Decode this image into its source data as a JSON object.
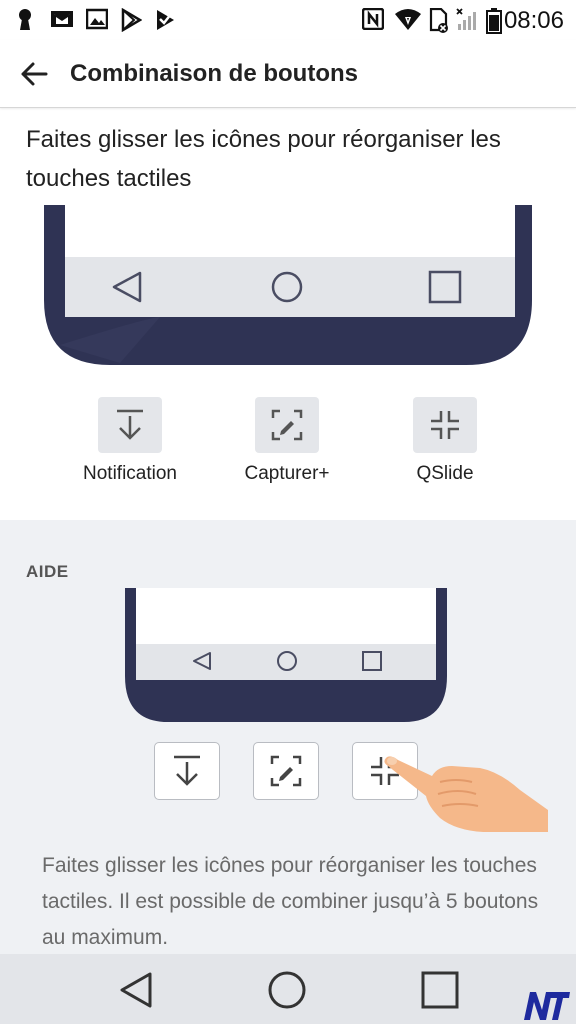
{
  "status_bar": {
    "time": "08:06",
    "left_icons": [
      "keyhole-icon",
      "gmail-icon",
      "gallery-icon",
      "play-store-icon",
      "play-check-icon"
    ],
    "right_icons": [
      "nfc-icon",
      "wifi-icon",
      "no-sim-icon",
      "signal-icon",
      "battery-icon"
    ]
  },
  "header": {
    "title": "Combinaison de boutons",
    "back_icon": "arrow-left-icon"
  },
  "instruction": "Faites glisser les icônes pour réorganiser les touches tactiles",
  "buttons": [
    {
      "label": "Notification",
      "icon": "notification-down-icon"
    },
    {
      "label": "Capturer+",
      "icon": "capture-plus-icon"
    },
    {
      "label": "QSlide",
      "icon": "qslide-icon"
    }
  ],
  "help": {
    "title": "AIDE",
    "text": "Faites glisser les icônes pour réorganiser les touches tactiles. Il est possible de combiner jusqu’à 5 boutons au maximum."
  },
  "nav": {
    "back_icon": "triangle-back-icon",
    "home_icon": "circle-home-icon",
    "recents_icon": "square-recents-icon"
  },
  "colors": {
    "phone_frame": "#2f3354",
    "nav_preview": "#e3e5e9",
    "help_bg": "#eff1f4",
    "hand": "#f5b88a"
  }
}
